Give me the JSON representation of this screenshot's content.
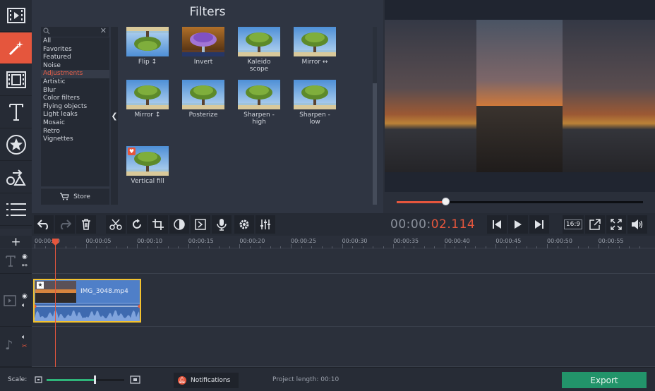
{
  "filters_panel": {
    "title": "Filters",
    "categories": [
      "All",
      "Favorites",
      "Featured",
      "Noise",
      "Adjustments",
      "Artistic",
      "Blur",
      "Color filters",
      "Flying objects",
      "Light leaks",
      "Mosaic",
      "Retro",
      "Vignettes"
    ],
    "selected_category": "Adjustments",
    "store_label": "Store",
    "filters": [
      {
        "label": "Flip ↕"
      },
      {
        "label": "Invert"
      },
      {
        "label": "Kaleido\nscope"
      },
      {
        "label": "Mirror ↔"
      },
      {
        "label": "Mirror ↕"
      },
      {
        "label": "Posterize"
      },
      {
        "label": "Sharpen -\nhigh"
      },
      {
        "label": "Sharpen -\nlow"
      },
      {
        "label": "Vertical fill",
        "favorite": true
      }
    ]
  },
  "player": {
    "timecode_dim": "00:00:",
    "timecode_red": "02.114",
    "aspect_ratio": "16:9",
    "progress_fraction": 0.2
  },
  "timeline": {
    "ruler_labels": [
      "00:00:00",
      "00:00:05",
      "00:00:10",
      "00:00:15",
      "00:00:20",
      "00:00:25",
      "00:00:30",
      "00:00:35",
      "00:00:40",
      "00:00:45",
      "00:00:50",
      "00:00:55"
    ],
    "clip_name": "IMG_3048.mp4",
    "add_track_symbol": "+"
  },
  "bottom_bar": {
    "scale_label": "Scale:",
    "scale_fraction": 0.62,
    "notifications_label": "Notifications",
    "project_length": "Project length:  00:10",
    "export_label": "Export"
  },
  "colors": {
    "accent": "#e5563d",
    "export": "#22946a",
    "clip_border": "#f2c12e"
  }
}
